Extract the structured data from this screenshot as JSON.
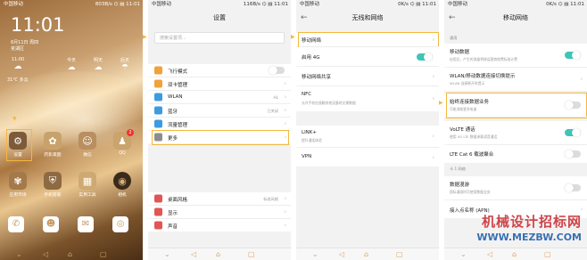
{
  "screen1": {
    "status": {
      "carrier": "中国移动",
      "right": "803B/s ⌬ ▤ 11:01"
    },
    "clock": "11:01",
    "date": "8月11日 周四",
    "location": "芜湖区",
    "weather": {
      "w1": "11:00",
      "w2": "今天",
      "w3": "明天",
      "w4": "后天"
    },
    "temperature": "31℃ 多云",
    "apps": [
      {
        "label": "设置"
      },
      {
        "label": "药影美图"
      },
      {
        "label": "微信"
      },
      {
        "label": "QQ",
        "badge": "2"
      },
      {
        "label": "应用市场"
      },
      {
        "label": "手机管家"
      },
      {
        "label": "实用工具"
      },
      {
        "label": "相机"
      }
    ]
  },
  "screen2": {
    "status": {
      "carrier": "中国移动",
      "right": "116B/s ⌬ ▤ 11:01"
    },
    "title": "设置",
    "search_placeholder": "搜索设置项...",
    "items": [
      {
        "label": "飞行模式"
      },
      {
        "label": "双卡管理"
      },
      {
        "label": "WLAN",
        "value": "HL"
      },
      {
        "label": "蓝牙",
        "value": "已关闭"
      },
      {
        "label": "流量管理"
      },
      {
        "label": "更多"
      },
      {
        "label": "桌面风格",
        "value": "标准风格"
      },
      {
        "label": "显示"
      },
      {
        "label": "声音"
      }
    ]
  },
  "screen3": {
    "status": {
      "carrier": "中国移动",
      "right": "0K/s ⌬ ▤ 11:01"
    },
    "title": "无线和网络",
    "items": [
      {
        "label": "移动网络"
      },
      {
        "label": "启用 4G"
      },
      {
        "label": "移动网络共享"
      },
      {
        "label": "NFC",
        "sub": "允许手机在接触其他设备时交换数据"
      },
      {
        "label": "LINK+",
        "sub": "提升通话体验"
      },
      {
        "label": "VPN"
      }
    ]
  },
  "screen4": {
    "status": {
      "carrier": "中国移动",
      "right": "0K/s ⌬ ▤ 11:01"
    },
    "title": "移动网络",
    "section_general": "通用",
    "items": [
      {
        "label": "移动数据",
        "sub": "启用后，产生的流量将按运营商收费标准计费"
      },
      {
        "label": "WLAN/移动数据连接切换提示",
        "sub": "WLAN 连接断开时提示"
      },
      {
        "label": "始终连接数据业务",
        "sub": "可能消耗更多电量"
      },
      {
        "label": "VoLTE 通话",
        "sub": "使用 4G LTE 数据承载语音通话"
      },
      {
        "label": "LTE Cat 6 载波聚合"
      }
    ],
    "section_card1": "卡 1 网络",
    "roaming": {
      "label": "数据漫游",
      "sub": "国际漫游时可使用数据业务"
    },
    "apn": {
      "label": "接入点名称 (APN)"
    },
    "watermark1": "机械设计招标网",
    "watermark2": "WWW.MEZBW.COM"
  },
  "colors": {
    "accent": "#3ec5b7",
    "highlight": "#f5b83b"
  }
}
